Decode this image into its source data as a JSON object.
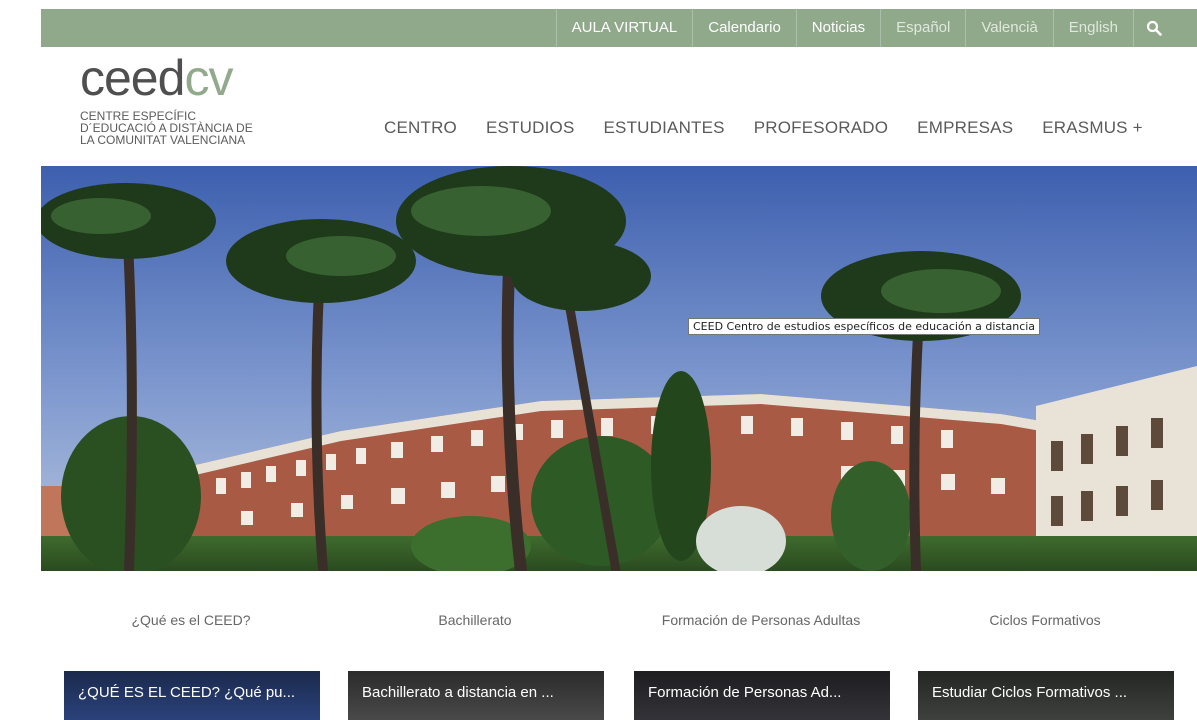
{
  "topnav": {
    "items": [
      {
        "label": "AULA VIRTUAL",
        "style": "strong"
      },
      {
        "label": "Calendario",
        "style": "strong"
      },
      {
        "label": "Noticias",
        "style": "strong"
      },
      {
        "label": "Español",
        "style": "lang"
      },
      {
        "label": "Valencià",
        "style": "lang"
      },
      {
        "label": "English",
        "style": "lang"
      }
    ],
    "search_icon": "search-icon"
  },
  "logo": {
    "word_a": "ceed",
    "word_b": "cv",
    "tagline": [
      "CENTRE ESPECÍFIC",
      "D´EDUCACIÓ A DISTÀNCIA DE",
      "LA COMUNITAT VALENCIANA"
    ]
  },
  "mainnav": {
    "items": [
      "CENTRO",
      "ESTUDIOS",
      "ESTUDIANTES",
      "PROFESORADO",
      "EMPRESAS",
      "ERASMUS +"
    ]
  },
  "hero": {
    "tooltip": "CEED Centro de estudios específicos de educación a distancia"
  },
  "sections": [
    {
      "title": "¿Qué es el CEED?",
      "video_title": "¿QUÉ ES EL CEED? ¿Qué pu..."
    },
    {
      "title": "Bachillerato",
      "video_title": "Bachillerato a distancia en ..."
    },
    {
      "title": "Formación de Personas Adultas",
      "video_title": "Formación de Personas Ad..."
    },
    {
      "title": "Ciclos Formativos",
      "video_title": "Estudiar Ciclos Formativos ..."
    }
  ],
  "colors": {
    "topbar": "#8fa98a",
    "brand_green": "#90aa8b",
    "brand_grey": "#4f4f4f"
  }
}
